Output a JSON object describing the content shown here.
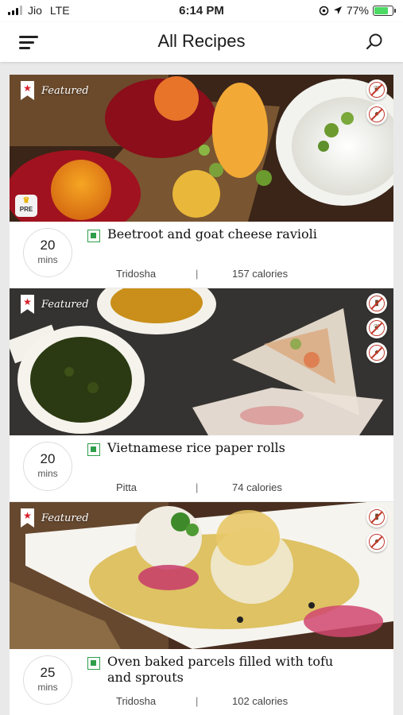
{
  "status_bar": {
    "carrier": "Jio",
    "network": "LTE",
    "time": "6:14 PM",
    "battery": "77%",
    "battery_level": 0.77
  },
  "header": {
    "title": "All Recipes",
    "menu_icon": "hamburger-menu-icon",
    "search_icon": "search-icon"
  },
  "featured_label": "Featured",
  "premium_badge": "PRE",
  "recipes": [
    {
      "title": "Beetroot and goat cheese ravioli",
      "time": "20",
      "time_unit": "mins",
      "dosha": "Tridosha",
      "calories": "157 calories",
      "premium": true,
      "diet_icons": [
        "no-gluten-icon",
        "no-nut-icon"
      ]
    },
    {
      "title": "Vietnamese rice paper rolls",
      "time": "20",
      "time_unit": "mins",
      "dosha": "Pitta",
      "calories": "74 calories",
      "premium": false,
      "diet_icons": [
        "no-dairy-icon",
        "no-gluten-icon",
        "no-nut-icon"
      ]
    },
    {
      "title": "Oven baked parcels filled with tofu and sprouts",
      "time": "25",
      "time_unit": "mins",
      "dosha": "Tridosha",
      "calories": "102 calories",
      "premium": false,
      "diet_icons": [
        "no-dairy-icon",
        "no-nut-icon"
      ]
    }
  ],
  "colors": {
    "accent_red": "#d6202a",
    "veg_green": "#2e9e4a",
    "background": "#e9e9e9"
  }
}
